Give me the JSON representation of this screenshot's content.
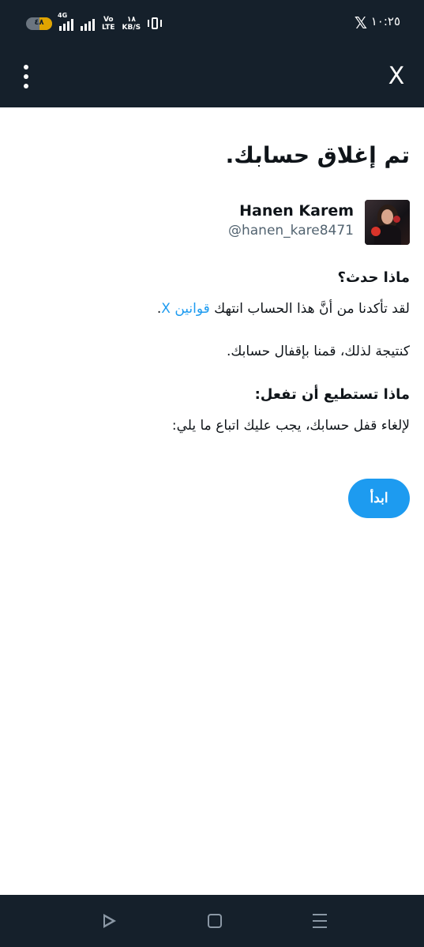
{
  "status_bar": {
    "time": "١٠:٢٥",
    "notification_icon": "x-logo-icon",
    "x_glyph": "𝕏",
    "network": "4G",
    "volte_line1": "Vo",
    "volte_line2": "LTE",
    "speed_value": "١٨",
    "speed_unit": "KB/S",
    "battery_label": "٤٨",
    "battery_level": 0.48,
    "battery_color": "#e0a400"
  },
  "app_bar": {
    "close_glyph": "X",
    "background": "#15202b"
  },
  "page": {
    "title": "تم إغلاق حسابك.",
    "user": {
      "display_name": "Hanen Karem",
      "handle": "@hanen_kare8471"
    },
    "what_happened": {
      "heading": "ماذا حدث؟",
      "line1_before": "لقد تأكدنا من أنَّ هذا الحساب انتهك ",
      "line1_link": "قوانين X",
      "line1_after": ".",
      "line2": "كنتيجة لذلك، قمنا بإقفال حسابك."
    },
    "what_you_can_do": {
      "heading": "ماذا تستطيع أن تفعل:",
      "text": "لإلغاء قفل حسابك، يجب عليك اتباع ما يلي:"
    },
    "start_button": "ابدأ",
    "accent_color": "#1d9bf0"
  }
}
